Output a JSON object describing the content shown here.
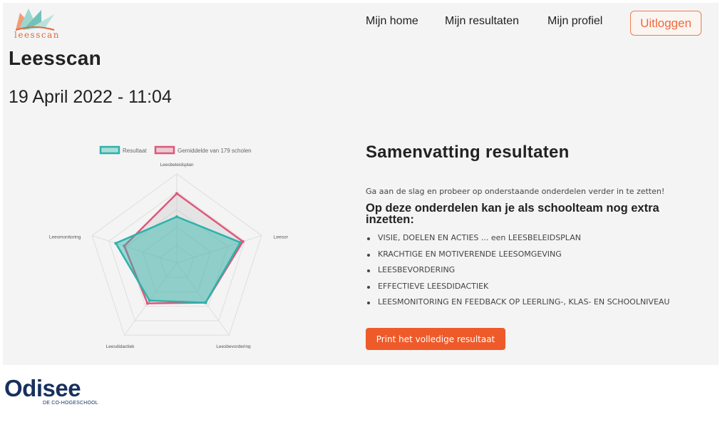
{
  "brand": {
    "logo_text": "leesscan"
  },
  "nav": {
    "home": "Mijn home",
    "results": "Mijn resultaten",
    "profile": "Mijn profiel",
    "logout": "Uitloggen"
  },
  "page": {
    "title": "Leesscan",
    "date": "19 April 2022 - 11:04"
  },
  "summary": {
    "title": "Samenvatting resultaten",
    "intro": "Ga aan de slag en probeer op onderstaande onderdelen verder in te zetten!",
    "subheading": "Op deze onderdelen kan je als schoolteam nog extra inzetten:",
    "items": [
      "VISIE, DOELEN EN ACTIES ... een LEESBELEIDSPLAN",
      "KRACHTIGE EN MOTIVERENDE LEESOMGEVING",
      "LEESBEVORDERING",
      "EFFECTIEVE LEESDIDACTIEK",
      "LEESMONITORING EN FEEDBACK OP LEERLING-, KLAS- EN SCHOOLNIVEAU"
    ],
    "print_button": "Print het volledige resultaat"
  },
  "footer": {
    "org_name": "Odisee",
    "org_tagline": "DE CO-HOGESCHOOL"
  },
  "colors": {
    "accent": "#ef5a2a",
    "result": "#2bb3aa",
    "average": "#e0577a",
    "footer_brand": "#17305e"
  },
  "chart_data": {
    "type": "radar",
    "axes": [
      "Leesbeleidsplan",
      "Leesomgeving",
      "Leesbevordering",
      "Leesdidactiek",
      "Leesmonitoring"
    ],
    "rmax": 100,
    "series": [
      {
        "name": "Resultaat",
        "values": [
          52,
          75,
          55,
          52,
          72
        ]
      },
      {
        "name": "Gemiddelde van 179 scholen",
        "values": [
          78,
          78,
          55,
          56,
          62
        ]
      }
    ]
  }
}
